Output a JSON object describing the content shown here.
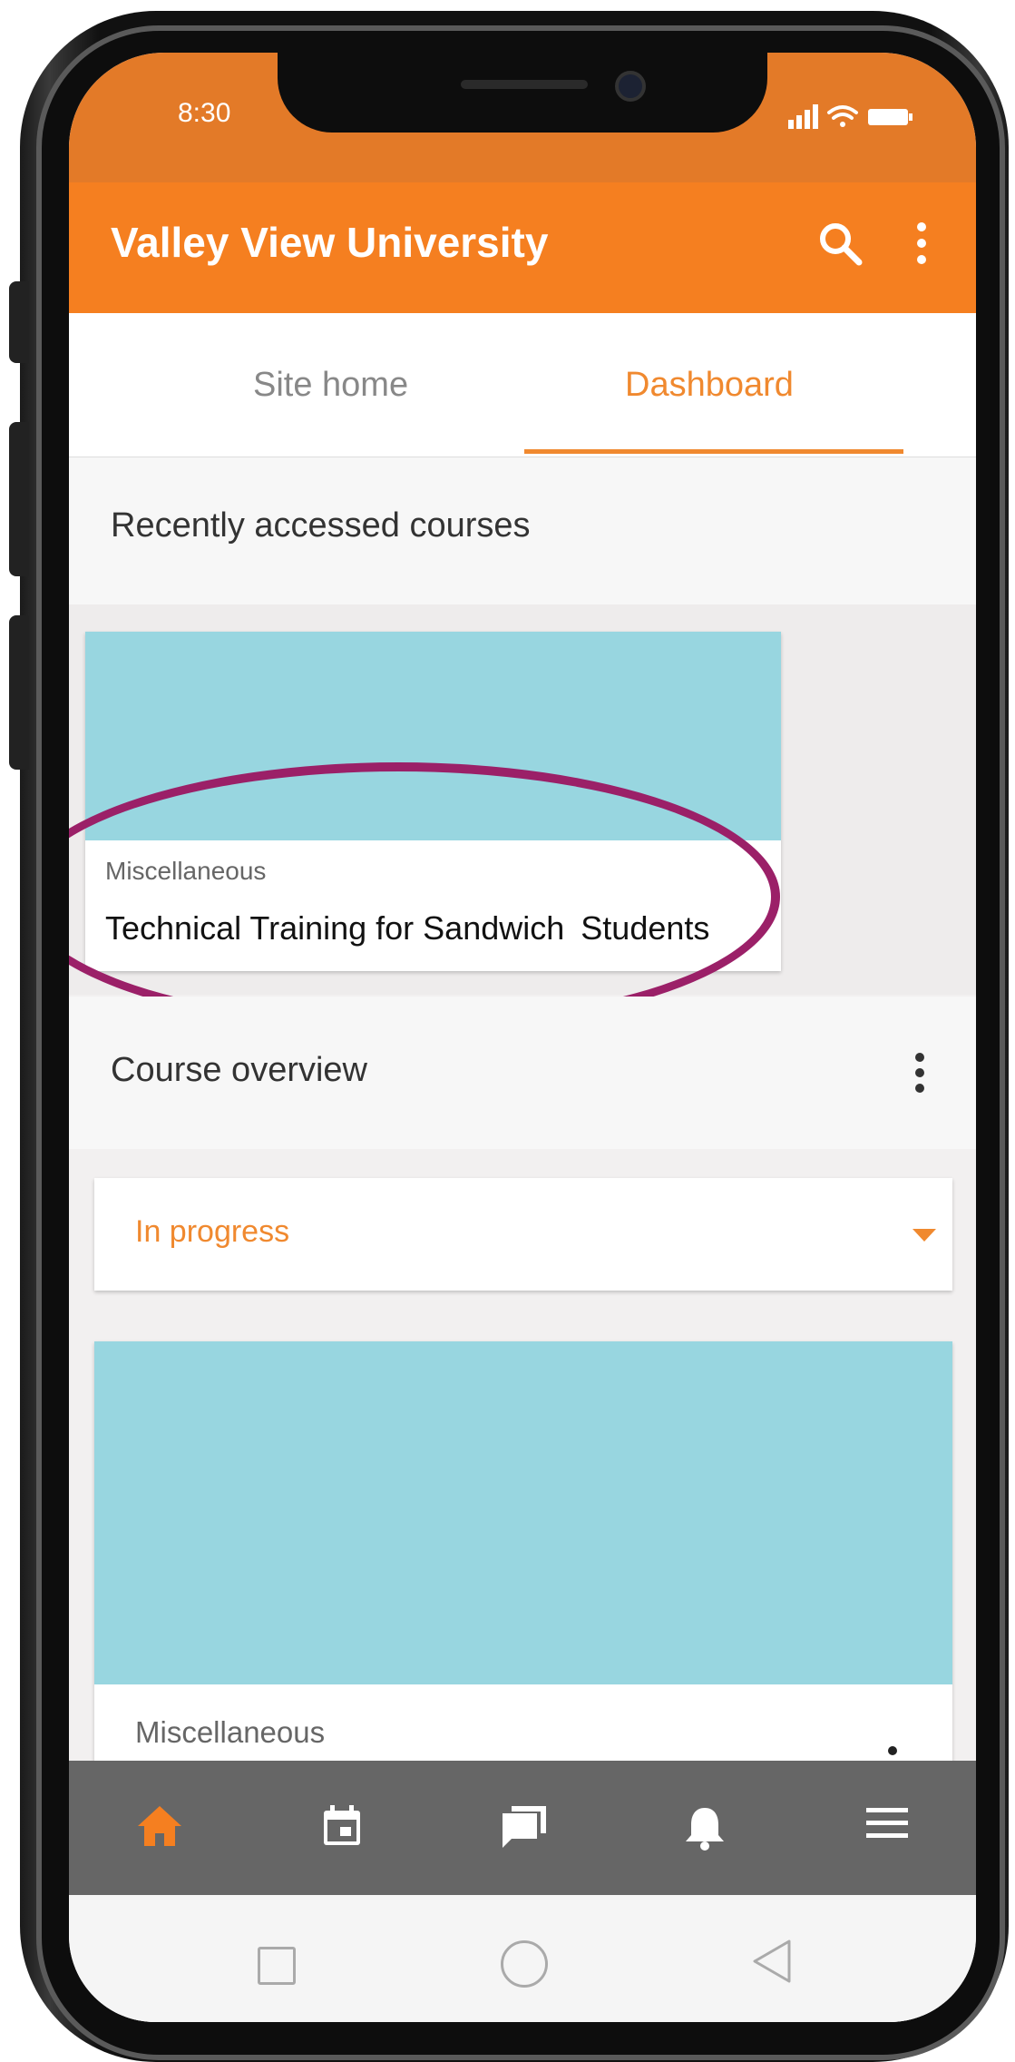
{
  "status_bar": {
    "time": "8:30"
  },
  "app_bar": {
    "title": "Valley View University",
    "actions": [
      "search-icon",
      "more-vertical-icon"
    ]
  },
  "tabs": [
    {
      "label": "Site home",
      "active": false
    },
    {
      "label": "Dashboard",
      "active": true
    }
  ],
  "recent": {
    "title": "Recently accessed courses",
    "courses": [
      {
        "category": "Miscellaneous",
        "name_part1": "Technical Training for Sandwich",
        "name_part2": "Students"
      }
    ]
  },
  "overview": {
    "title": "Course overview",
    "filter": "In progress",
    "courses": [
      {
        "category": "Miscellaneous"
      }
    ]
  },
  "bottom_nav": [
    "home-icon",
    "calendar-icon",
    "messages-icon",
    "notifications-icon",
    "menu-icon"
  ],
  "colors": {
    "brand": "#f57f20",
    "accent": "#f0892f",
    "card_image": "#98d6e0",
    "highlight": "#9b2068",
    "nav_bg": "#666666"
  }
}
